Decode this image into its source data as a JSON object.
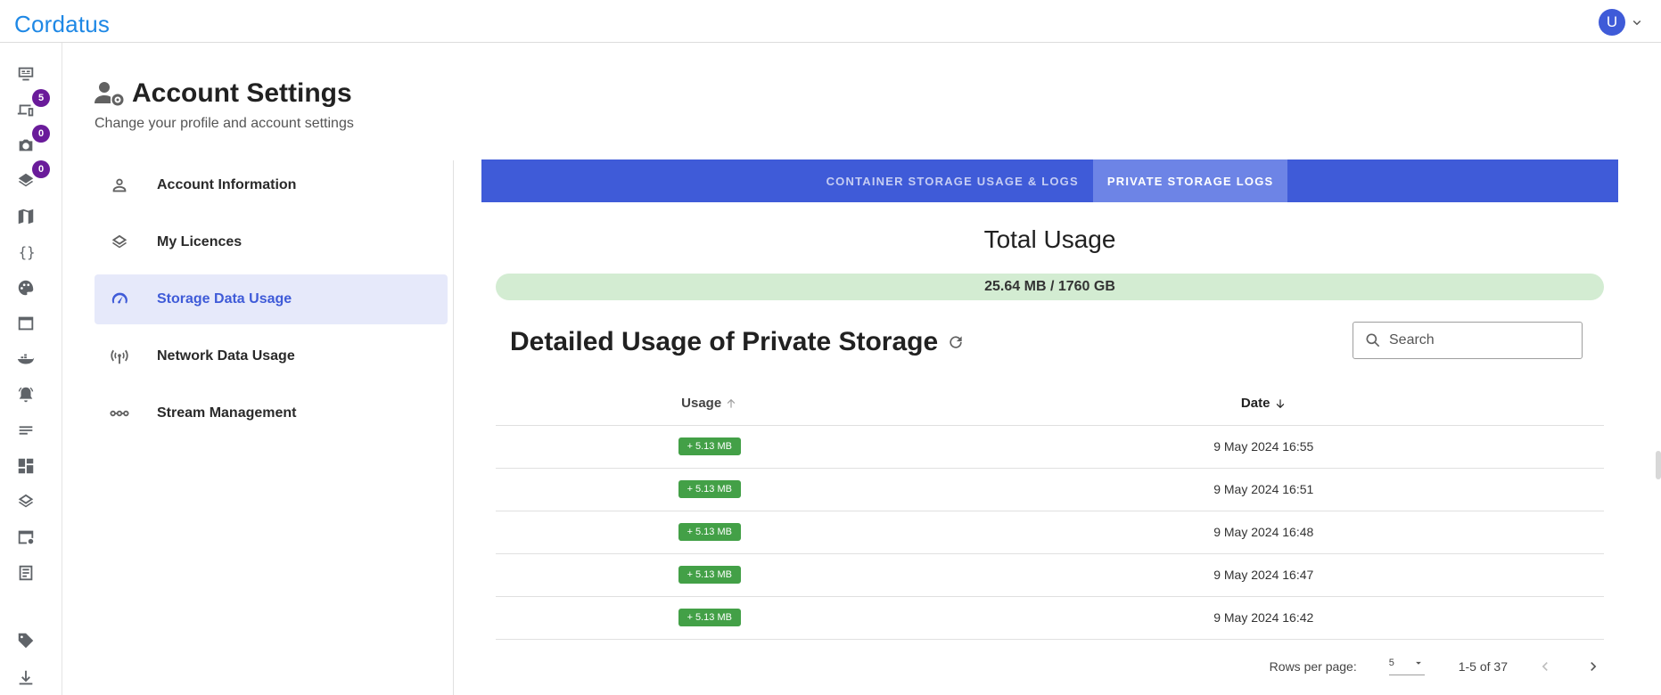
{
  "app": {
    "brand": "Cordatus"
  },
  "user": {
    "initial": "U"
  },
  "rail": {
    "items": [
      {
        "name": "monitor-icon"
      },
      {
        "name": "devices-icon",
        "badge": "5"
      },
      {
        "name": "camera-icon",
        "badge": "0"
      },
      {
        "name": "layers-icon",
        "badge": "0"
      },
      {
        "name": "map-icon"
      },
      {
        "name": "code-braces-icon"
      },
      {
        "name": "palette-icon"
      },
      {
        "name": "window-icon"
      },
      {
        "name": "docker-icon"
      },
      {
        "name": "alarm-bell-icon"
      },
      {
        "name": "lines-icon"
      },
      {
        "name": "dashboard-icon"
      },
      {
        "name": "stack-icon"
      },
      {
        "name": "window-settings-icon"
      },
      {
        "name": "document-icon"
      },
      {
        "name": "tag-icon"
      },
      {
        "name": "download-icon"
      }
    ]
  },
  "header": {
    "title": "Account Settings",
    "subtitle": "Change your profile and account settings"
  },
  "settings_nav": {
    "items": [
      {
        "label": "Account Information",
        "icon": "person-icon"
      },
      {
        "label": "My Licences",
        "icon": "layers-icon"
      },
      {
        "label": "Storage Data Usage",
        "icon": "speedometer-icon",
        "active": true
      },
      {
        "label": "Network Data Usage",
        "icon": "antenna-icon"
      },
      {
        "label": "Stream Management",
        "icon": "stream-icon"
      }
    ]
  },
  "tabs": [
    {
      "label": "CONTAINER STORAGE USAGE & LOGS",
      "active": false
    },
    {
      "label": "PRIVATE STORAGE LOGS",
      "active": true
    }
  ],
  "total_usage": {
    "title": "Total Usage",
    "value": "25.64 MB / 1760 GB"
  },
  "detail": {
    "title": "Detailed Usage of Private Storage",
    "search_placeholder": "Search"
  },
  "table": {
    "columns": [
      "Usage",
      "Date"
    ],
    "rows": [
      {
        "usage": "5.13 MB",
        "date": "9 May 2024 16:55"
      },
      {
        "usage": "5.13 MB",
        "date": "9 May 2024 16:51"
      },
      {
        "usage": "5.13 MB",
        "date": "9 May 2024 16:48"
      },
      {
        "usage": "5.13 MB",
        "date": "9 May 2024 16:47"
      },
      {
        "usage": "5.13 MB",
        "date": "9 May 2024 16:42"
      }
    ]
  },
  "pagination": {
    "rows_per_page_label": "Rows per page:",
    "rows_per_page": "5",
    "range": "1-5 of 37"
  },
  "colors": {
    "accent": "#3f5bd8",
    "tab_active": "#6d84e6",
    "usage_bar": "#d3ecd2",
    "chip": "#43a047",
    "badge": "#6a1b9a",
    "brand": "#1e88e5"
  }
}
